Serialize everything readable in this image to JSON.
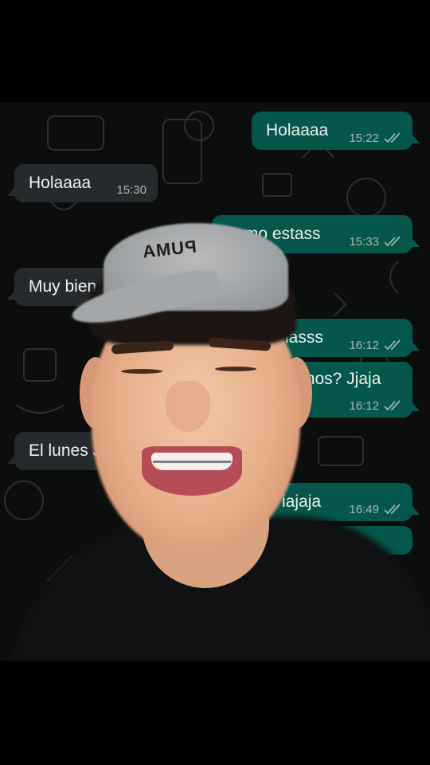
{
  "chat": {
    "messages": [
      {
        "direction": "out",
        "text": "Holaaaa",
        "time": "15:22",
        "read": true
      },
      {
        "direction": "in",
        "text": "Holaaaa",
        "time": "15:30"
      },
      {
        "direction": "out",
        "text": "Como estass",
        "time": "15:33",
        "read": true
      },
      {
        "direction": "in",
        "text": "Muy bien"
      },
      {
        "direction": "out",
        "text": "iasss",
        "time": "16:12",
        "read": true
      },
      {
        "direction": "out",
        "text": "mos? Jjaja",
        "time": "16:12",
        "read": true
      },
      {
        "direction": "in",
        "text": "El lunes J"
      },
      {
        "direction": "out",
        "text": "iajaja",
        "time": "16:49",
        "read": true
      }
    ]
  },
  "overlay": {
    "cap_text": "PUMA"
  },
  "colors": {
    "incoming_bubble": "#262a2c",
    "outgoing_bubble": "#04574a",
    "chat_background": "#0c0d0d",
    "read_tick": "#9fb7b1"
  },
  "icons": {
    "read_receipt": "double-check-icon"
  }
}
